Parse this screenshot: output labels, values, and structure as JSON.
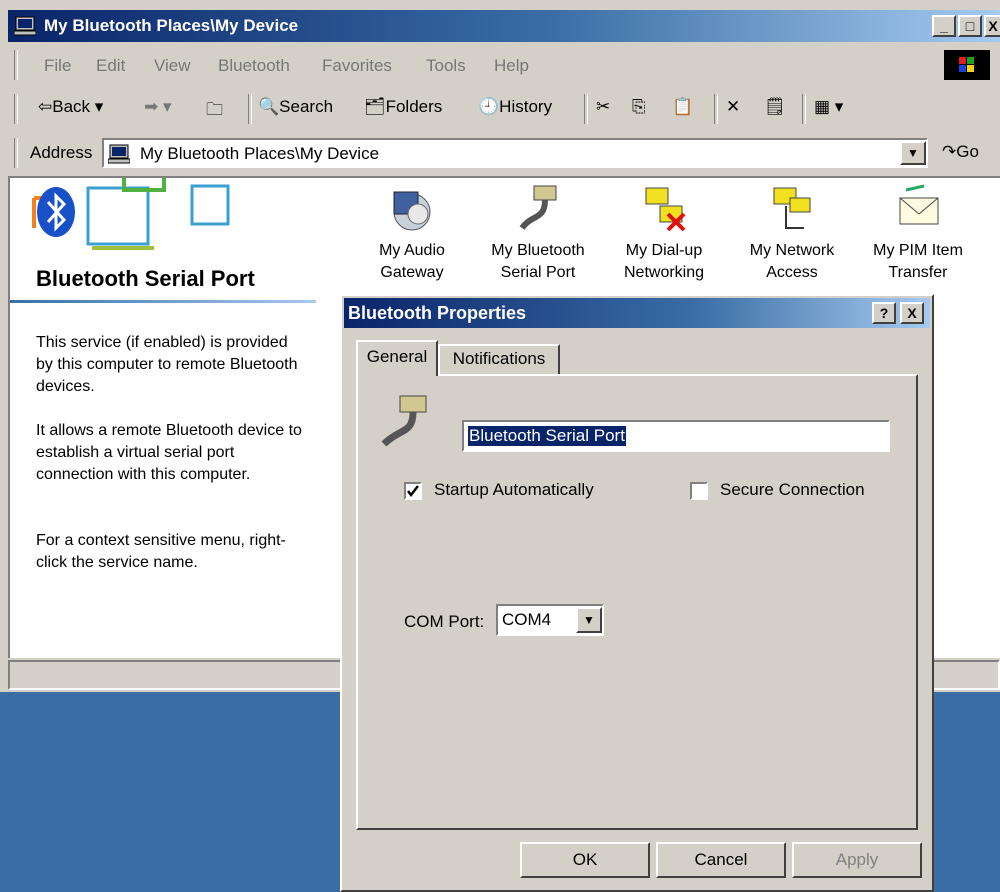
{
  "explorer": {
    "title": "My Bluetooth Places\\My Device",
    "menu": [
      "File",
      "Edit",
      "View",
      "Bluetooth",
      "Favorites",
      "Tools",
      "Help"
    ],
    "toolbar": {
      "back": "Back",
      "search": "Search",
      "folders": "Folders",
      "history": "History"
    },
    "address_label": "Address",
    "address_value": "My Bluetooth Places\\My Device",
    "go_label": "Go",
    "left_pane": {
      "title": "Bluetooth Serial Port",
      "para1": "This service (if enabled) is provided by this computer to remote Bluetooth devices.",
      "para2": "It allows a remote Bluetooth device to establish a virtual serial port connection with this computer.",
      "para3": "For a context sensitive menu, right-click the service name."
    },
    "devices": [
      {
        "line1": "My Audio",
        "line2": "Gateway",
        "icon": "headset-icon"
      },
      {
        "line1": "My Bluetooth",
        "line2": "Serial Port",
        "icon": "serial-cable-icon"
      },
      {
        "line1": "My Dial-up",
        "line2": "Networking",
        "icon": "dialup-icon"
      },
      {
        "line1": "My Network",
        "line2": "Access",
        "icon": "network-icon"
      },
      {
        "line1": "My PIM Item",
        "line2": "Transfer",
        "icon": "envelope-icon"
      }
    ]
  },
  "dialog": {
    "title": "Bluetooth Properties",
    "tabs": [
      "General",
      "Notifications"
    ],
    "service_name": "Bluetooth Serial Port",
    "startup_label": "Startup Automatically",
    "startup_checked": true,
    "secure_label": "Secure Connection",
    "secure_checked": false,
    "com_label": "COM Port:",
    "com_value": "COM4",
    "buttons": {
      "ok": "OK",
      "cancel": "Cancel",
      "apply": "Apply"
    }
  },
  "colors": {
    "desktop": "#3a6ea5",
    "title_active": "#0a246a",
    "face": "#d4d0c8"
  }
}
